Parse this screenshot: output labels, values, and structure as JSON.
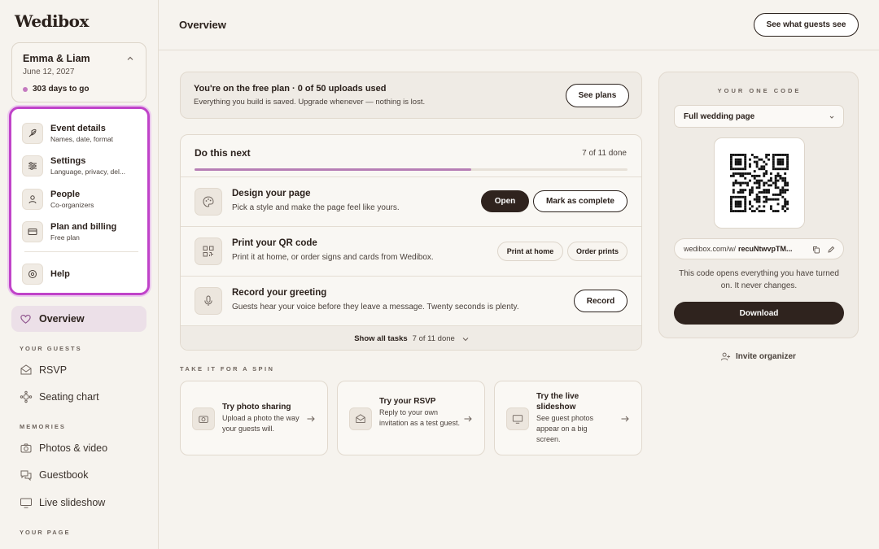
{
  "brand": {
    "logo": "Wedibox"
  },
  "couple": {
    "names": "Emma & Liam",
    "date": "June 12, 2027",
    "countdown": "303 days to go"
  },
  "menu": {
    "items": [
      {
        "title": "Event details",
        "subtitle": "Names, date, format",
        "icon": "feather-icon"
      },
      {
        "title": "Settings",
        "subtitle": "Language, privacy, del...",
        "icon": "sliders-icon"
      },
      {
        "title": "People",
        "subtitle": "Co-organizers",
        "icon": "people-icon"
      },
      {
        "title": "Plan and billing",
        "subtitle": "Free plan",
        "icon": "card-icon"
      },
      {
        "title": "Help",
        "subtitle": "",
        "icon": "help-icon"
      }
    ]
  },
  "nav": {
    "overview": "Overview",
    "section_guests": "YOUR GUESTS",
    "rsvp": "RSVP",
    "seating": "Seating chart",
    "section_memories": "MEMORIES",
    "photos": "Photos & video",
    "guestbook": "Guestbook",
    "slideshow": "Live slideshow",
    "section_page": "YOUR PAGE"
  },
  "header": {
    "title": "Overview",
    "guest_view_button": "See what guests see"
  },
  "plan": {
    "title": "You're on the free plan · 0 of 50 uploads used",
    "subtitle": "Everything you build is saved. Upgrade whenever — nothing is lost.",
    "button": "See plans"
  },
  "tasks": {
    "heading": "Do this next",
    "count": "7 of 11 done",
    "progress": 0.64,
    "rows": [
      {
        "title": "Design your page",
        "subtitle": "Pick a style and make the page feel like yours.",
        "primary": "Open",
        "secondary": "Mark as complete",
        "icon": "palette-icon"
      },
      {
        "title": "Print your QR code",
        "subtitle": "Print it at home, or order signs and cards from Wedibox.",
        "primary": "Print at home",
        "secondary": "Order prints",
        "icon": "qr-icon"
      },
      {
        "title": "Record your greeting",
        "subtitle": "Guests hear your voice before they leave a message. Twenty seconds is plenty.",
        "primary": "Record",
        "icon": "mic-icon"
      }
    ],
    "footer_label": "Show all tasks",
    "footer_count": "7 of 11 done"
  },
  "spin": {
    "label": "TAKE IT FOR A SPIN",
    "cards": [
      {
        "title": "Try photo sharing",
        "subtitle": "Upload a photo the way your guests will.",
        "icon": "camera-icon"
      },
      {
        "title": "Try your RSVP",
        "subtitle": "Reply to your own invitation as a test guest.",
        "icon": "envelope-icon"
      },
      {
        "title": "Try the live slideshow",
        "subtitle": "See guest photos appear on a big screen.",
        "icon": "monitor-icon"
      }
    ]
  },
  "code": {
    "label": "YOUR ONE CODE",
    "select_value": "Full wedding page",
    "url_prefix": "wedibox.com/w/",
    "url_code": "recuNtwvpTM...",
    "note": "This code opens everything you have turned on. It never changes.",
    "download": "Download",
    "invite": "Invite organizer"
  },
  "colors": {
    "accent": "#c043c9",
    "dark": "#2f231e",
    "background": "#f6f3ee"
  }
}
